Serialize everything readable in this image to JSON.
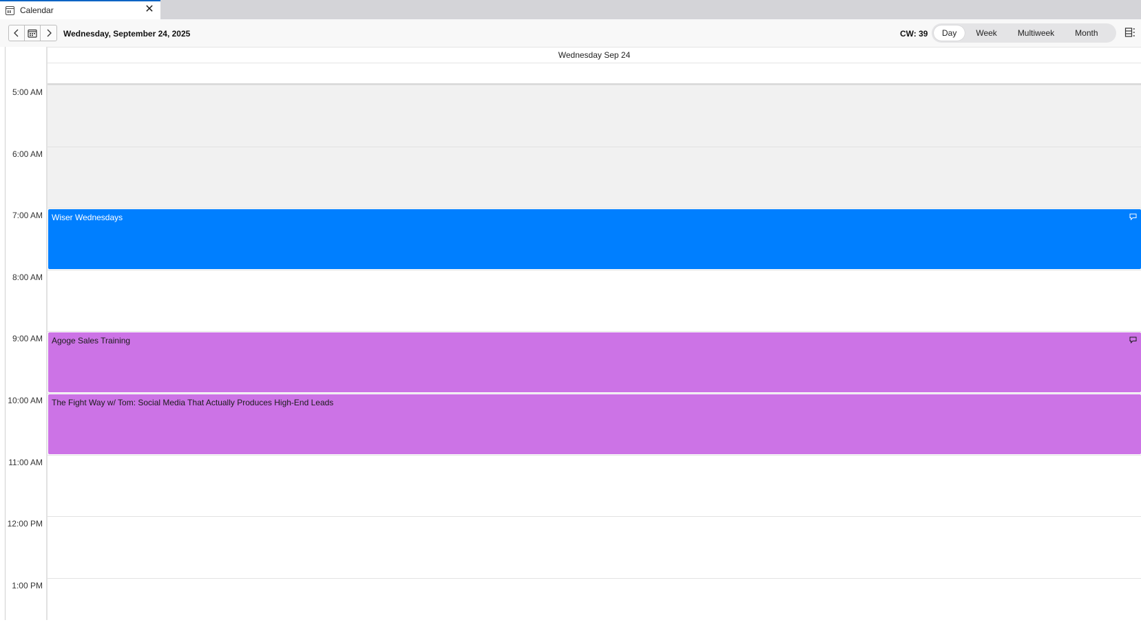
{
  "tab": {
    "label": "Calendar",
    "close_glyph": "✕",
    "icon": "calendar-icon"
  },
  "toolbar": {
    "date_title": "Wednesday, September 24, 2025",
    "calendar_week": "CW: 39",
    "views": [
      "Day",
      "Week",
      "Multiweek",
      "Month"
    ],
    "active_view": "Day",
    "icons": [
      "chevron-left-icon",
      "calendar-today-icon",
      "chevron-right-icon",
      "view-settings-icon"
    ]
  },
  "day_header": {
    "label": "Wednesday Sep 24"
  },
  "hours": [
    "5:00 AM",
    "6:00 AM",
    "7:00 AM",
    "8:00 AM",
    "9:00 AM",
    "10:00 AM",
    "11:00 AM",
    "12:00 PM",
    "1:00 PM"
  ],
  "events": [
    {
      "title": "Wiser Wednesdays",
      "start": "7:00 AM",
      "end": "8:00 AM",
      "color": "#007fff",
      "text_color": "#ffffff",
      "icon": "chat-bubble-icon"
    },
    {
      "title": "Agoge Sales Training",
      "start": "9:00 AM",
      "end": "10:00 AM",
      "color": "#cc73e6",
      "text_color": "#1a1a1a",
      "icon": "chat-bubble-icon"
    },
    {
      "title": "The Fight Way w/ Tom: Social Media That Actually Produces High-End Leads",
      "start": "10:00 AM",
      "end": "11:00 AM",
      "color": "#cc73e6",
      "text_color": "#1a1a1a"
    }
  ],
  "colors": {
    "accent": "#0a64c4",
    "off_hours": "#f1f1f1"
  }
}
